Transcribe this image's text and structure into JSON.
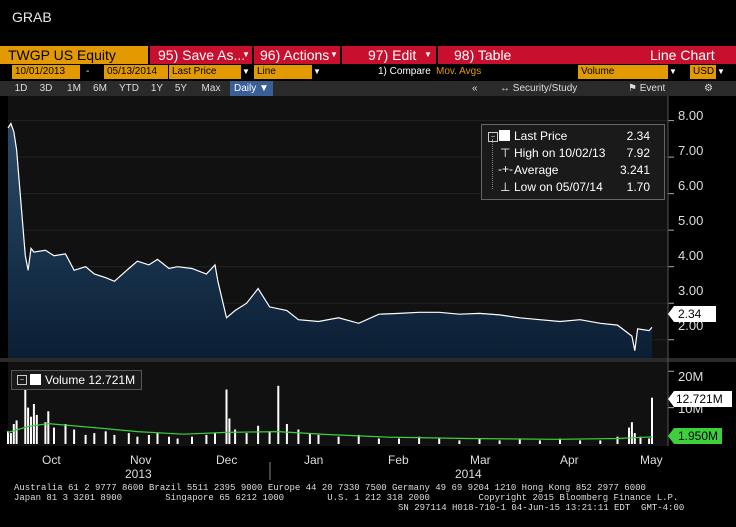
{
  "window": {
    "title": "GRAB"
  },
  "toolbar": {
    "ticker": "TWGP US Equity",
    "save_as": "95) Save As...",
    "actions": "96) Actions",
    "edit": "97) Edit",
    "table": "98) Table",
    "chart_type": "Line Chart"
  },
  "params": {
    "start_date": "10/01/2013",
    "dash": "-",
    "end_date": "05/13/2014",
    "field": "Last Price",
    "style": "Line",
    "compare": "1) Compare",
    "mov_avgs": "Mov. Avgs",
    "lower_field": "Volume",
    "currency": "USD"
  },
  "range": {
    "buttons": [
      "1D",
      "3D",
      "1M",
      "6M",
      "YTD",
      "1Y",
      "5Y",
      "Max"
    ],
    "period": "Daily",
    "collapse": "«",
    "security_study": "Security/Study",
    "event": "Event"
  },
  "legend": {
    "last_price_label": "Last Price",
    "last_price_value": "2.34",
    "high_label": "High on 10/02/13",
    "high_value": "7.92",
    "average_label": "Average",
    "average_value": "3.241",
    "low_label": "Low on 05/07/14",
    "low_value": "1.70"
  },
  "volume_legend": {
    "label": "Volume",
    "value": "12.721M"
  },
  "price_axis": {
    "ticks": [
      "8.00",
      "7.00",
      "6.00",
      "5.00",
      "4.00",
      "3.00",
      "2.00"
    ],
    "last_tag": "2.34"
  },
  "volume_axis": {
    "ticks": [
      "20M",
      "10M"
    ],
    "last_tag": "12.721M",
    "avg_tag": "1.950M"
  },
  "time_axis": {
    "months": [
      "Oct",
      "Nov",
      "Dec",
      "Jan",
      "Feb",
      "Mar",
      "Apr",
      "May"
    ],
    "years": [
      "2013",
      "2014"
    ]
  },
  "footer": {
    "line1": "Australia 61 2 9777 8600 Brazil 5511 2395 9000 Europe 44 20 7330 7500 Germany 49 69 9204 1210 Hong Kong 852 2977 6000",
    "line2": "Japan 81 3 3201 8900        Singapore 65 6212 1000        U.S. 1 212 318 2000         Copyright 2015 Bloomberg Finance L.P.",
    "line3": "SN 297114 H018-710-1 04-Jun-15 13:21:11 EDT  GMT-4:00"
  },
  "colors": {
    "command_bar": "#c8102e",
    "amber": "#e39a00",
    "volume_avg": "#3cd03c",
    "price_line": "#ffffff"
  },
  "chart_data": {
    "type": "area",
    "title": "",
    "x_range": [
      "2013-10-01",
      "2014-05-13"
    ],
    "price": {
      "ylim": [
        1.5,
        8.4
      ],
      "points": [
        [
          "2013-10-01",
          7.8
        ],
        [
          "2013-10-02",
          7.92
        ],
        [
          "2013-10-03",
          7.7
        ],
        [
          "2013-10-04",
          7.2
        ],
        [
          "2013-10-07",
          4.3
        ],
        [
          "2013-10-08",
          3.9
        ],
        [
          "2013-10-09",
          4.5
        ],
        [
          "2013-10-10",
          4.4
        ],
        [
          "2013-10-14",
          4.45
        ],
        [
          "2013-10-17",
          4.3
        ],
        [
          "2013-10-21",
          4.35
        ],
        [
          "2013-10-24",
          3.9
        ],
        [
          "2013-10-28",
          4.0
        ],
        [
          "2013-10-31",
          3.8
        ],
        [
          "2013-11-04",
          3.7
        ],
        [
          "2013-11-07",
          3.6
        ],
        [
          "2013-11-12",
          3.95
        ],
        [
          "2013-11-15",
          4.15
        ],
        [
          "2013-11-19",
          4.05
        ],
        [
          "2013-11-22",
          4.2
        ],
        [
          "2013-11-26",
          3.95
        ],
        [
          "2013-11-29",
          4.0
        ],
        [
          "2013-12-04",
          3.95
        ],
        [
          "2013-12-09",
          3.8
        ],
        [
          "2013-12-12",
          4.05
        ],
        [
          "2013-12-13",
          3.6
        ],
        [
          "2013-12-16",
          2.6
        ],
        [
          "2013-12-19",
          2.8
        ],
        [
          "2013-12-23",
          3.0
        ],
        [
          "2013-12-27",
          3.4
        ],
        [
          "2013-12-31",
          2.9
        ],
        [
          "2014-01-06",
          2.8
        ],
        [
          "2014-01-10",
          2.55
        ],
        [
          "2014-01-17",
          2.5
        ],
        [
          "2014-01-24",
          2.6
        ],
        [
          "2014-01-31",
          2.45
        ],
        [
          "2014-02-07",
          2.7
        ],
        [
          "2014-02-14",
          2.72
        ],
        [
          "2014-02-21",
          2.75
        ],
        [
          "2014-02-28",
          2.75
        ],
        [
          "2014-03-07",
          2.7
        ],
        [
          "2014-03-14",
          2.72
        ],
        [
          "2014-03-21",
          2.68
        ],
        [
          "2014-03-28",
          2.6
        ],
        [
          "2014-04-04",
          2.55
        ],
        [
          "2014-04-11",
          2.5
        ],
        [
          "2014-04-18",
          2.55
        ],
        [
          "2014-04-25",
          2.45
        ],
        [
          "2014-05-01",
          2.4
        ],
        [
          "2014-05-06",
          2.1
        ],
        [
          "2014-05-07",
          1.7
        ],
        [
          "2014-05-08",
          2.3
        ],
        [
          "2014-05-12",
          2.25
        ],
        [
          "2014-05-13",
          2.34
        ]
      ]
    },
    "volume": {
      "ylim": [
        0,
        22
      ],
      "unit": "M",
      "bars": [
        [
          "2013-10-01",
          3.5
        ],
        [
          "2013-10-02",
          3.0
        ],
        [
          "2013-10-03",
          5.5
        ],
        [
          "2013-10-04",
          6.5
        ],
        [
          "2013-10-07",
          15.0
        ],
        [
          "2013-10-08",
          10.0
        ],
        [
          "2013-10-09",
          7.5
        ],
        [
          "2013-10-10",
          11.0
        ],
        [
          "2013-10-11",
          8.0
        ],
        [
          "2013-10-14",
          6.0
        ],
        [
          "2013-10-15",
          9.0
        ],
        [
          "2013-10-17",
          4.5
        ],
        [
          "2013-10-21",
          5.5
        ],
        [
          "2013-10-24",
          4.0
        ],
        [
          "2013-10-28",
          2.5
        ],
        [
          "2013-10-31",
          3.0
        ],
        [
          "2013-11-04",
          3.5
        ],
        [
          "2013-11-07",
          2.5
        ],
        [
          "2013-11-12",
          3.0
        ],
        [
          "2013-11-15",
          2.0
        ],
        [
          "2013-11-19",
          2.5
        ],
        [
          "2013-11-22",
          3.0
        ],
        [
          "2013-11-26",
          2.0
        ],
        [
          "2013-11-29",
          1.5
        ],
        [
          "2013-12-04",
          2.0
        ],
        [
          "2013-12-09",
          2.5
        ],
        [
          "2013-12-12",
          3.0
        ],
        [
          "2013-12-16",
          15.0
        ],
        [
          "2013-12-17",
          7.0
        ],
        [
          "2013-12-19",
          4.0
        ],
        [
          "2013-12-23",
          3.0
        ],
        [
          "2013-12-27",
          5.0
        ],
        [
          "2013-12-31",
          3.5
        ],
        [
          "2014-01-03",
          16.0
        ],
        [
          "2014-01-06",
          5.5
        ],
        [
          "2014-01-10",
          4.0
        ],
        [
          "2014-01-14",
          3.0
        ],
        [
          "2014-01-17",
          2.5
        ],
        [
          "2014-01-24",
          2.0
        ],
        [
          "2014-01-31",
          2.5
        ],
        [
          "2014-02-07",
          1.5
        ],
        [
          "2014-02-14",
          1.5
        ],
        [
          "2014-02-21",
          2.0
        ],
        [
          "2014-02-28",
          1.5
        ],
        [
          "2014-03-07",
          1.0
        ],
        [
          "2014-03-14",
          1.5
        ],
        [
          "2014-03-21",
          1.0
        ],
        [
          "2014-03-28",
          1.5
        ],
        [
          "2014-04-04",
          1.0
        ],
        [
          "2014-04-11",
          1.5
        ],
        [
          "2014-04-18",
          1.0
        ],
        [
          "2014-04-25",
          1.0
        ],
        [
          "2014-05-01",
          2.0
        ],
        [
          "2014-05-05",
          4.5
        ],
        [
          "2014-05-06",
          6.0
        ],
        [
          "2014-05-07",
          3.0
        ],
        [
          "2014-05-09",
          2.0
        ],
        [
          "2014-05-12",
          1.5
        ],
        [
          "2014-05-13",
          12.721
        ]
      ],
      "average": [
        [
          "2013-10-01",
          3.2
        ],
        [
          "2013-10-08",
          4.8
        ],
        [
          "2013-10-15",
          5.6
        ],
        [
          "2013-10-31",
          4.5
        ],
        [
          "2013-11-15",
          3.4
        ],
        [
          "2013-12-01",
          2.7
        ],
        [
          "2013-12-16",
          3.2
        ],
        [
          "2014-01-03",
          3.4
        ],
        [
          "2014-01-20",
          2.6
        ],
        [
          "2014-02-10",
          1.9
        ],
        [
          "2014-03-10",
          1.5
        ],
        [
          "2014-04-10",
          1.3
        ],
        [
          "2014-05-01",
          1.5
        ],
        [
          "2014-05-13",
          1.95
        ]
      ]
    }
  }
}
